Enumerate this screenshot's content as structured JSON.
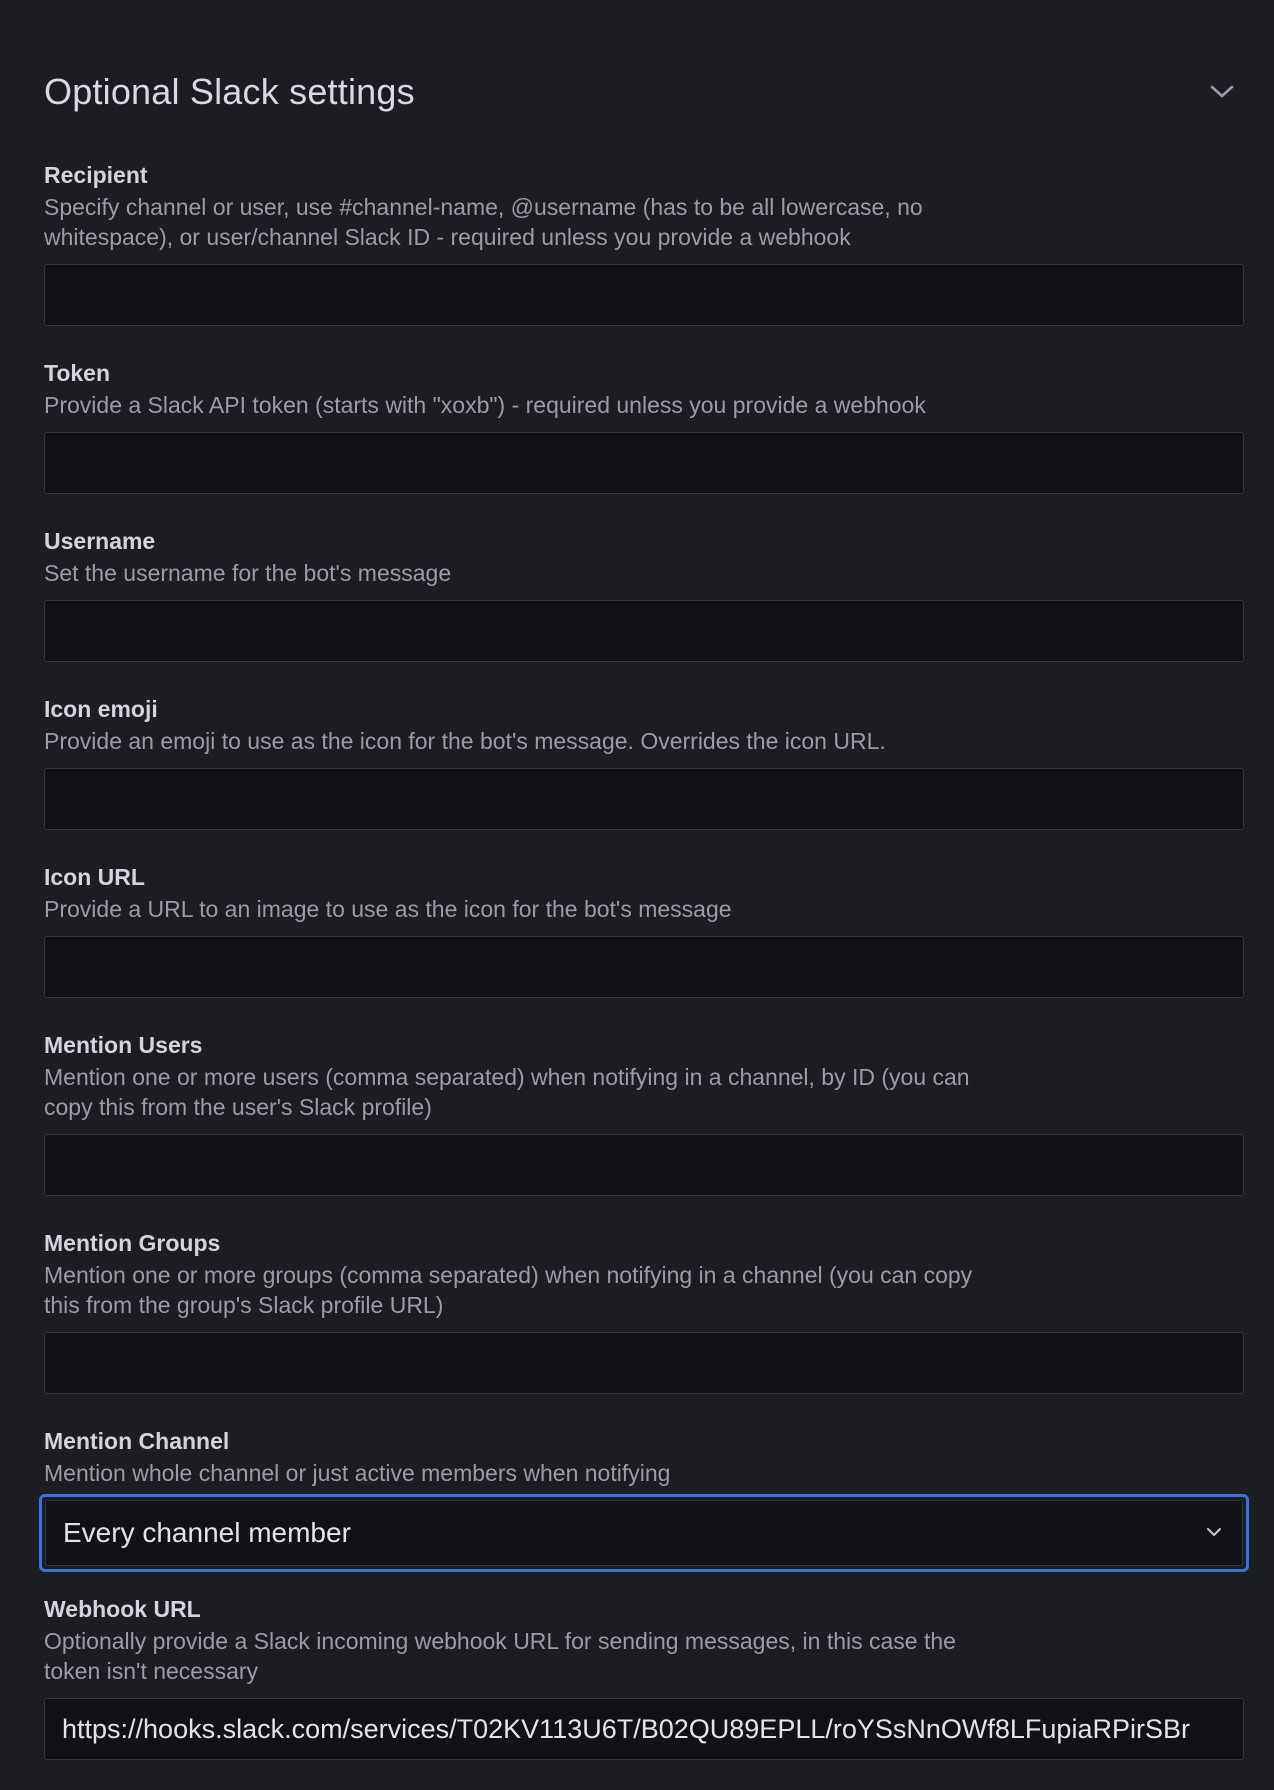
{
  "section": {
    "title": "Optional Slack settings"
  },
  "fields": {
    "recipient": {
      "label": "Recipient",
      "description": "Specify channel or user, use #channel-name, @username (has to be all lowercase, no whitespace), or user/channel Slack ID - required unless you provide a webhook",
      "value": ""
    },
    "token": {
      "label": "Token",
      "description": "Provide a Slack API token (starts with \"xoxb\") - required unless you provide a webhook",
      "value": ""
    },
    "username": {
      "label": "Username",
      "description": "Set the username for the bot's message",
      "value": ""
    },
    "icon_emoji": {
      "label": "Icon emoji",
      "description": "Provide an emoji to use as the icon for the bot's message. Overrides the icon URL.",
      "value": ""
    },
    "icon_url": {
      "label": "Icon URL",
      "description": "Provide a URL to an image to use as the icon for the bot's message",
      "value": ""
    },
    "mention_users": {
      "label": "Mention Users",
      "description": "Mention one or more users (comma separated) when notifying in a channel, by ID (you can copy this from the user's Slack profile)",
      "value": ""
    },
    "mention_groups": {
      "label": "Mention Groups",
      "description": "Mention one or more groups (comma separated) when notifying in a channel (you can copy this from the group's Slack profile URL)",
      "value": ""
    },
    "mention_channel": {
      "label": "Mention Channel",
      "description": "Mention whole channel or just active members when notifying",
      "selected": "Every channel member"
    },
    "webhook_url": {
      "label": "Webhook URL",
      "description": "Optionally provide a Slack incoming webhook URL for sending messages, in this case the token isn't necessary",
      "value": "https://hooks.slack.com/services/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"
    }
  },
  "colors": {
    "background": "#1c1d22",
    "input_background": "#111217",
    "focus_border": "#3d71d9"
  },
  "icons": {
    "collapse": "chevron-down-icon",
    "select": "chevron-down-icon"
  }
}
